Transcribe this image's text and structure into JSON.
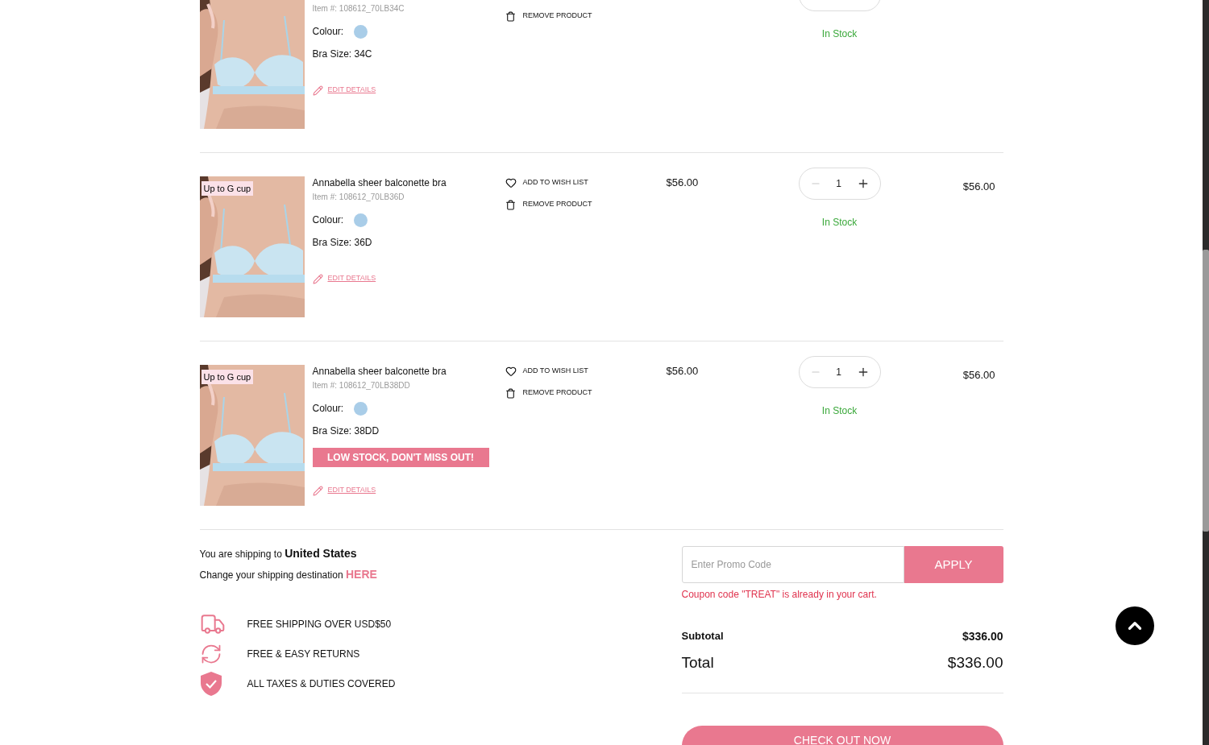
{
  "cart_items": [
    {
      "item_number": "Item #: 108612_70LB34C",
      "colour_label": "Colour:",
      "color": "#a9cde8",
      "size": "Bra Size: 34C",
      "edit_link": "EDIT DETAILS",
      "remove_label": "REMOVE PRODUCT",
      "stock": "In Stock"
    },
    {
      "badge": "Up to G cup",
      "name": "Annabella sheer balconette bra",
      "item_number": "Item #: 108612_70LB36D",
      "colour_label": "Colour:",
      "color": "#a9cde8",
      "size": "Bra Size: 36D",
      "edit_link": "EDIT DETAILS",
      "wishlist_label": "ADD TO WISH LIST",
      "remove_label": "REMOVE PRODUCT",
      "price": "$56.00",
      "quantity": "1",
      "stock": "In Stock",
      "line_total": "$56.00"
    },
    {
      "badge": "Up to G cup",
      "name": "Annabella sheer balconette bra",
      "item_number": "Item #: 108612_70LB38DD",
      "colour_label": "Colour:",
      "color": "#a9cde8",
      "size": "Bra Size: 38DD",
      "alert": "LOW STOCK, DON'T MISS OUT!",
      "edit_link": "EDIT DETAILS",
      "wishlist_label": "ADD TO WISH LIST",
      "remove_label": "REMOVE PRODUCT",
      "price": "$56.00",
      "quantity": "1",
      "stock": "In Stock",
      "line_total": "$56.00"
    }
  ],
  "shipping": {
    "text": "You are shipping to **United States**",
    "change_text": "Change your shipping destination",
    "change_link": "HERE"
  },
  "features": [
    {
      "kind": "truck",
      "label": "FREE SHIPPING OVER USD$50"
    },
    {
      "kind": "returns",
      "label": "FREE & EASY RETURNS"
    },
    {
      "kind": "shield",
      "label": "ALL TAXES & DUTIES COVERED"
    }
  ],
  "promo": {
    "placeholder": "Enter Promo Code",
    "button": "APPLY",
    "message": "Coupon code \"TREAT\" is already in your cart."
  },
  "summary": {
    "subtotal_label": "Subtotal",
    "subtotal": "$336.00",
    "total_label": "Total",
    "total": "$336.00"
  },
  "checkout_button": "CHECK OUT NOW"
}
